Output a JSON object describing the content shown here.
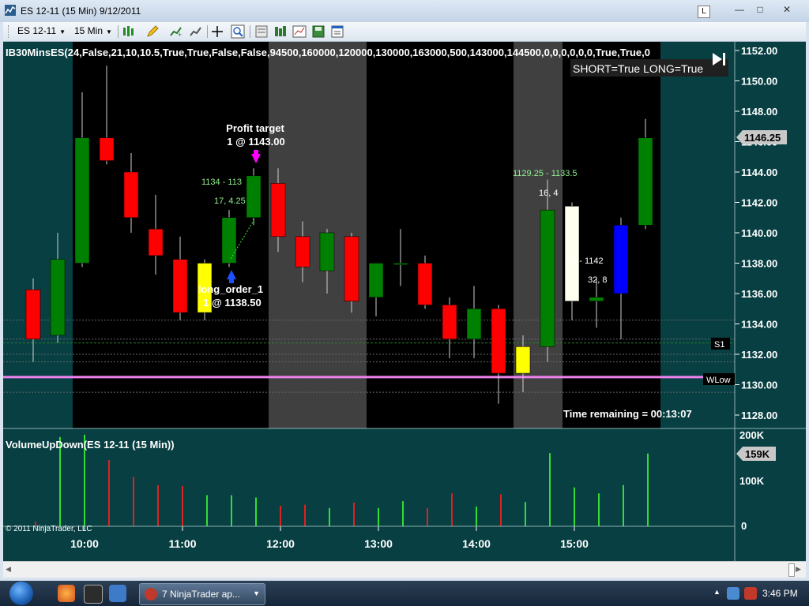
{
  "window": {
    "title": "ES 12-11 (15 Min)  9/12/2011",
    "layout_badge": "L",
    "minimize_label": "—",
    "maximize_label": "□",
    "close_label": "✕"
  },
  "toolbar": {
    "instrument": "ES 12-11",
    "interval": "15 Min",
    "icons": [
      "bars-style-icon",
      "pencil-draw-icon",
      "add-indicator-icon",
      "remove-indicator-icon",
      "crosshair-icon",
      "zoom-icon",
      "data-box-icon",
      "strategies-icon",
      "chart-trader-icon",
      "save-icon",
      "properties-icon"
    ]
  },
  "colors": {
    "background": "#073f42",
    "session_black": "#000000",
    "session_gray": "#404040",
    "up": "#008000",
    "down": "#ff0000",
    "yellow": "#ffff00",
    "cream": "#fffff0",
    "blue": "#0000ff",
    "magenta_line": "#ee82ee",
    "vol_up": "#33dd33",
    "vol_down": "#dd2222"
  },
  "chart": {
    "indicator_header": "IB30MinsES(24,False,21,10,10.5,True,True,False,False,94500,160000,120000,130000,163000,500,143000,144500,0,0,0,0,0,0,True,True,0",
    "status_box": "SHORT=True LONG=True",
    "profit_target_label_1": "Profit target",
    "profit_target_label_2": "1 @ 1143.00",
    "long_order_label_1": "long_order_1",
    "long_order_label_2": "1 @ 1138.50",
    "anno_1134": "1134 - 113",
    "anno_17": "17, 4.25",
    "anno_range": "1129.25 - 1133.5",
    "anno_16": "16, 4",
    "anno_1142": "34 - 1142",
    "anno_32": "32, 8",
    "time_remaining": "Time remaining = 00:13:07",
    "s1_label": "S1",
    "wlow_label": "WLow",
    "price_axis": [
      "1152.00",
      "1150.00",
      "1148.00",
      "1146.00",
      "1144.00",
      "1142.00",
      "1140.00",
      "1138.00",
      "1136.00",
      "1134.00",
      "1132.00",
      "1130.00",
      "1128.00"
    ],
    "last_price": "1146.25",
    "volume_title": "VolumeUpDown(ES 12-11 (15 Min))",
    "volume_axis": [
      "200K",
      "100K",
      "0"
    ],
    "last_volume": "159K",
    "time_axis": [
      "10:00",
      "11:00",
      "12:00",
      "13:00",
      "14:00",
      "15:00"
    ],
    "copyright": "© 2011 NinjaTrader, LLC"
  },
  "chart_data": {
    "type": "candlestick",
    "title": "ES 12-11 (15 Min)",
    "xlabel": "",
    "ylabel": "",
    "ylim": [
      1127,
      1153
    ],
    "volume_ylim": [
      0,
      200000
    ],
    "candles": [
      {
        "time": "09:30",
        "open": 1133.0,
        "high": 1137.0,
        "low": 1131.5,
        "close": 1136.25,
        "color": "down",
        "volume": 10000
      },
      {
        "time": "09:45",
        "open": 1133.25,
        "high": 1140.0,
        "low": 1132.75,
        "close": 1138.25,
        "color": "up",
        "volume": 195000
      },
      {
        "time": "10:00",
        "open": 1138.0,
        "high": 1149.25,
        "low": 1137.75,
        "close": 1146.25,
        "color": "up",
        "volume": 200000
      },
      {
        "time": "10:15",
        "open": 1146.25,
        "high": 1151.0,
        "low": 1144.5,
        "close": 1144.75,
        "color": "down",
        "volume": 145000
      },
      {
        "time": "10:30",
        "open": 1144.0,
        "high": 1145.25,
        "low": 1140.0,
        "close": 1141.0,
        "color": "down",
        "volume": 108000
      },
      {
        "time": "10:45",
        "open": 1140.25,
        "high": 1142.5,
        "low": 1137.25,
        "close": 1138.5,
        "color": "down",
        "volume": 90000
      },
      {
        "time": "11:00",
        "open": 1138.25,
        "high": 1139.75,
        "low": 1134.25,
        "close": 1134.75,
        "color": "down",
        "volume": 88000
      },
      {
        "time": "11:15",
        "open": 1134.75,
        "high": 1138.25,
        "low": 1134.25,
        "close": 1138.0,
        "color": "yellow",
        "volume": 68000
      },
      {
        "time": "11:30",
        "open": 1138.0,
        "high": 1141.5,
        "low": 1137.75,
        "close": 1141.0,
        "color": "up",
        "volume": 68000
      },
      {
        "time": "11:45",
        "open": 1141.0,
        "high": 1144.25,
        "low": 1140.5,
        "close": 1143.75,
        "color": "up",
        "volume": 63000
      },
      {
        "time": "12:00",
        "open": 1143.25,
        "high": 1144.25,
        "low": 1138.75,
        "close": 1139.75,
        "color": "down",
        "volume": 45000
      },
      {
        "time": "12:15",
        "open": 1139.75,
        "high": 1140.75,
        "low": 1136.75,
        "close": 1137.75,
        "color": "down",
        "volume": 47000
      },
      {
        "time": "12:30",
        "open": 1137.5,
        "high": 1140.25,
        "low": 1136.0,
        "close": 1140.0,
        "color": "up",
        "volume": 40000
      },
      {
        "time": "12:45",
        "open": 1139.75,
        "high": 1140.0,
        "low": 1134.75,
        "close": 1135.5,
        "color": "down",
        "volume": 52000
      },
      {
        "time": "13:00",
        "open": 1135.75,
        "high": 1138.0,
        "low": 1134.5,
        "close": 1138.0,
        "color": "up",
        "volume": 40000
      },
      {
        "time": "13:15",
        "open": 1138.0,
        "high": 1140.25,
        "low": 1136.5,
        "close": 1138.0,
        "color": "up",
        "volume": 55000
      },
      {
        "time": "13:30",
        "open": 1138.0,
        "high": 1138.5,
        "low": 1135.0,
        "close": 1135.25,
        "color": "down",
        "volume": 40000
      },
      {
        "time": "13:45",
        "open": 1135.25,
        "high": 1135.75,
        "low": 1131.75,
        "close": 1133.0,
        "color": "down",
        "volume": 72000
      },
      {
        "time": "14:00",
        "open": 1133.0,
        "high": 1136.5,
        "low": 1131.75,
        "close": 1135.0,
        "color": "up",
        "volume": 43000
      },
      {
        "time": "14:15",
        "open": 1135.0,
        "high": 1135.25,
        "low": 1128.75,
        "close": 1130.75,
        "color": "down",
        "volume": 70000
      },
      {
        "time": "14:30",
        "open": 1130.75,
        "high": 1133.25,
        "low": 1129.5,
        "close": 1132.5,
        "color": "yellow",
        "volume": 53000
      },
      {
        "time": "14:45",
        "open": 1132.5,
        "high": 1143.5,
        "low": 1131.5,
        "close": 1141.5,
        "color": "up",
        "volume": 160000
      },
      {
        "time": "15:00",
        "open": 1135.5,
        "high": 1142.0,
        "low": 1134.25,
        "close": 1141.75,
        "color": "cream",
        "volume": 85000
      },
      {
        "time": "15:15",
        "open": 1135.75,
        "high": 1137.0,
        "low": 1133.75,
        "close": 1135.5,
        "color": "up",
        "volume": 72000
      },
      {
        "time": "15:30",
        "open": 1140.5,
        "high": 1141.0,
        "low": 1133.0,
        "close": 1136.0,
        "color": "blue",
        "volume": 90000
      },
      {
        "time": "15:45",
        "open": 1140.5,
        "high": 1147.5,
        "low": 1140.25,
        "close": 1146.25,
        "color": "up",
        "volume": 159000
      }
    ],
    "levels": [
      {
        "label": "S1",
        "value": 1132.75
      },
      {
        "label": "WLow",
        "value": 1130.5
      }
    ],
    "grid": false
  }
}
